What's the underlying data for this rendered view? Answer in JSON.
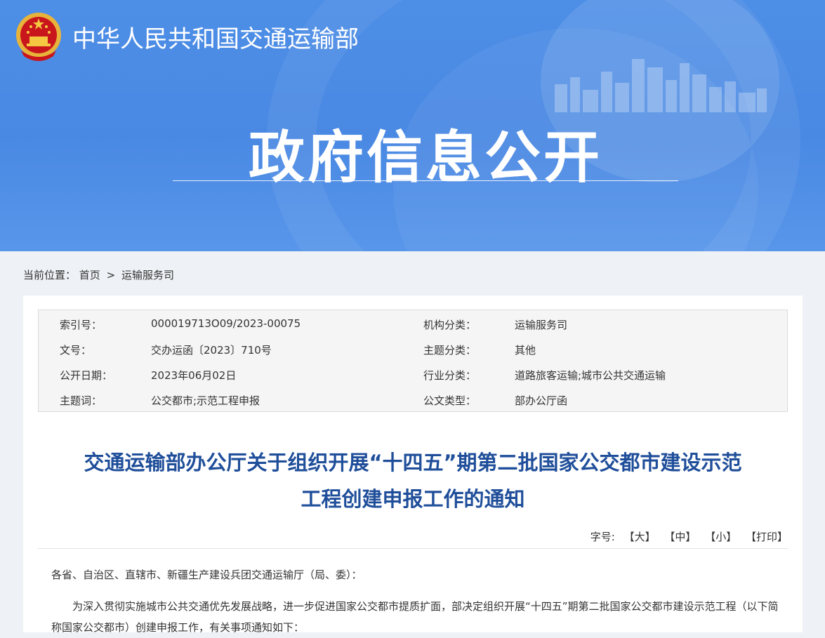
{
  "header": {
    "site_title": "中华人民共和国交通运输部",
    "banner_title": "政府信息公开",
    "emblem_icon": "national-emblem-icon"
  },
  "breadcrumb": {
    "label": "当前位置：",
    "home": "首页",
    "separator": ">",
    "current": "运输服务司"
  },
  "meta": {
    "rows": [
      {
        "k1": "索引号：",
        "v1": "000019713O09/2023-00075",
        "k2": "机构分类：",
        "v2": "运输服务司"
      },
      {
        "k1": "文号：",
        "v1": "交办运函〔2023〕710号",
        "k2": "主题分类：",
        "v2": "其他"
      },
      {
        "k1": "公开日期：",
        "v1": "2023年06月02日",
        "k2": "行业分类：",
        "v2": "道路旅客运输;城市公共交通运输"
      },
      {
        "k1": "主题词：",
        "v1": "公交都市;示范工程申报",
        "k2": "公文类型：",
        "v2": "部办公厅函"
      }
    ]
  },
  "document": {
    "title_line1": "交通运输部办公厅关于组织开展“十四五”期第二批国家公交都市建设示范",
    "title_line2": "工程创建申报工作的通知",
    "font_label": "字号:",
    "font_large": "【大】",
    "font_medium": "【中】",
    "font_small": "【小】",
    "print": "【打印】",
    "salutation": "各省、自治区、直辖市、新疆生产建设兵团交通运输厅（局、委）：",
    "paragraph1": "为深入贯彻实施城市公共交通优先发展战略，进一步促进国家公交都市提质扩面，部决定组织开展“十四五”期第二批国家公交都市建设示范工程（以下简称国家公交都市）创建申报工作，有关事项通知如下："
  },
  "colors": {
    "banner": "#4a89e3",
    "title_blue": "#1f4e9a",
    "meta_bg": "#f5f5f5"
  }
}
